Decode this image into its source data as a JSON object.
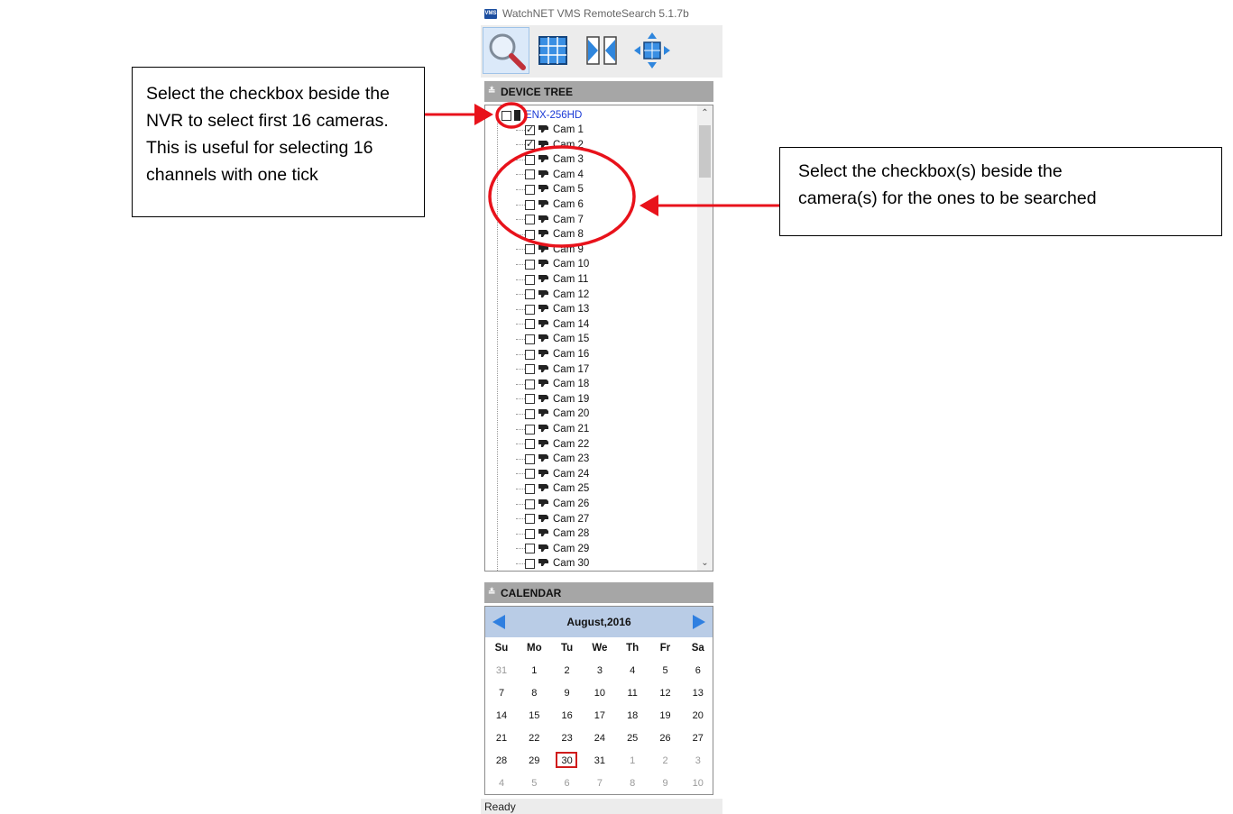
{
  "window": {
    "title": "WatchNET VMS RemoteSearch 5.1.7b",
    "logo_text": "VMS"
  },
  "toolbar": {
    "buttons": [
      {
        "icon": "search-icon",
        "active": true
      },
      {
        "icon": "grid-layout-icon",
        "active": false
      },
      {
        "icon": "split-view-icon",
        "active": false
      },
      {
        "icon": "ptz-move-icon",
        "active": false
      }
    ]
  },
  "device_tree": {
    "header": "DEVICE TREE",
    "device": {
      "label": "ENX-256HD",
      "checked": false
    },
    "cameras": [
      {
        "label": "Cam 1",
        "checked": true
      },
      {
        "label": "Cam 2",
        "checked": true
      },
      {
        "label": "Cam 3",
        "checked": false
      },
      {
        "label": "Cam 4",
        "checked": false
      },
      {
        "label": "Cam 5",
        "checked": false
      },
      {
        "label": "Cam 6",
        "checked": false
      },
      {
        "label": "Cam 7",
        "checked": false
      },
      {
        "label": "Cam 8",
        "checked": false
      },
      {
        "label": "Cam 9",
        "checked": false
      },
      {
        "label": "Cam 10",
        "checked": false
      },
      {
        "label": "Cam 11",
        "checked": false
      },
      {
        "label": "Cam 12",
        "checked": false
      },
      {
        "label": "Cam 13",
        "checked": false
      },
      {
        "label": "Cam 14",
        "checked": false
      },
      {
        "label": "Cam 15",
        "checked": false
      },
      {
        "label": "Cam 16",
        "checked": false
      },
      {
        "label": "Cam 17",
        "checked": false
      },
      {
        "label": "Cam 18",
        "checked": false
      },
      {
        "label": "Cam 19",
        "checked": false
      },
      {
        "label": "Cam 20",
        "checked": false
      },
      {
        "label": "Cam 21",
        "checked": false
      },
      {
        "label": "Cam 22",
        "checked": false
      },
      {
        "label": "Cam 23",
        "checked": false
      },
      {
        "label": "Cam 24",
        "checked": false
      },
      {
        "label": "Cam 25",
        "checked": false
      },
      {
        "label": "Cam 26",
        "checked": false
      },
      {
        "label": "Cam 27",
        "checked": false
      },
      {
        "label": "Cam 28",
        "checked": false
      },
      {
        "label": "Cam 29",
        "checked": false
      },
      {
        "label": "Cam 30",
        "checked": false
      }
    ]
  },
  "calendar": {
    "header": "CALENDAR",
    "month_label": "August,2016",
    "weekdays": [
      "Su",
      "Mo",
      "Tu",
      "We",
      "Th",
      "Fr",
      "Sa"
    ],
    "weeks": [
      [
        {
          "d": "31",
          "other": true
        },
        {
          "d": "1"
        },
        {
          "d": "2"
        },
        {
          "d": "3"
        },
        {
          "d": "4"
        },
        {
          "d": "5"
        },
        {
          "d": "6"
        }
      ],
      [
        {
          "d": "7"
        },
        {
          "d": "8"
        },
        {
          "d": "9"
        },
        {
          "d": "10"
        },
        {
          "d": "11"
        },
        {
          "d": "12"
        },
        {
          "d": "13"
        }
      ],
      [
        {
          "d": "14"
        },
        {
          "d": "15"
        },
        {
          "d": "16"
        },
        {
          "d": "17"
        },
        {
          "d": "18"
        },
        {
          "d": "19"
        },
        {
          "d": "20"
        }
      ],
      [
        {
          "d": "21"
        },
        {
          "d": "22"
        },
        {
          "d": "23"
        },
        {
          "d": "24"
        },
        {
          "d": "25"
        },
        {
          "d": "26"
        },
        {
          "d": "27"
        }
      ],
      [
        {
          "d": "28"
        },
        {
          "d": "29"
        },
        {
          "d": "30",
          "today": true
        },
        {
          "d": "31"
        },
        {
          "d": "1",
          "other": true
        },
        {
          "d": "2",
          "other": true
        },
        {
          "d": "3",
          "other": true
        }
      ],
      [
        {
          "d": "4",
          "other": true
        },
        {
          "d": "5",
          "other": true
        },
        {
          "d": "6",
          "other": true
        },
        {
          "d": "7",
          "other": true
        },
        {
          "d": "8",
          "other": true
        },
        {
          "d": "9",
          "other": true
        },
        {
          "d": "10",
          "other": true
        }
      ]
    ]
  },
  "status": {
    "text": "Ready"
  },
  "annotations": {
    "left_callout": [
      "Select the checkbox beside the",
      "NVR to select first 16 cameras.",
      "This is useful for selecting 16",
      "channels with one tick"
    ],
    "right_callout": [
      "Select the checkbox(s) beside the",
      "camera(s) for the ones to be searched"
    ],
    "highlight_color": "#e8121b"
  }
}
